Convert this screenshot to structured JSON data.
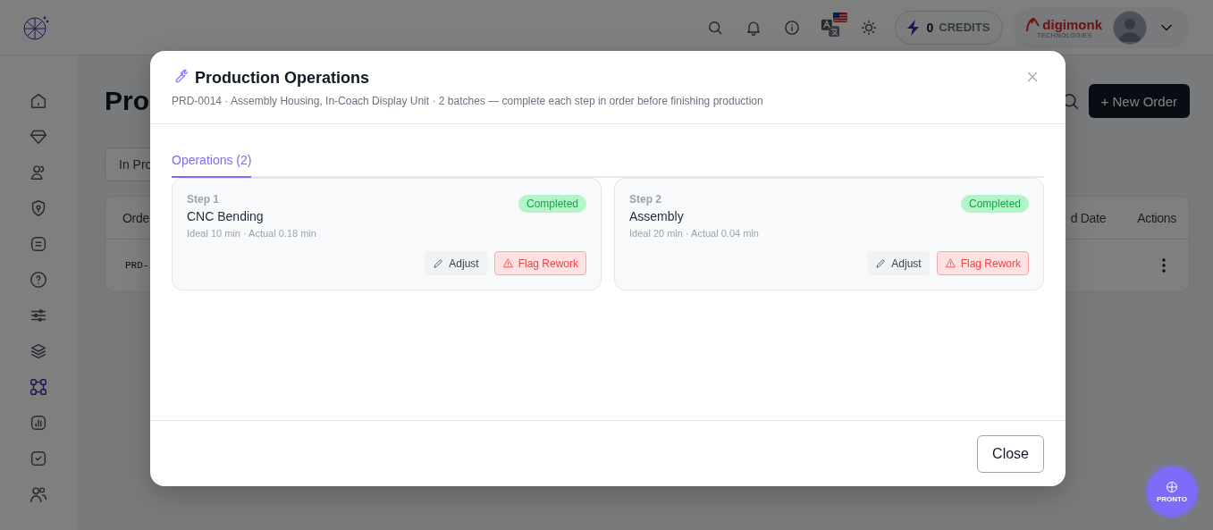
{
  "topbar": {
    "credits": {
      "count": "0",
      "label": "CREDITS"
    },
    "brand": {
      "name": "digimonk",
      "tagline": "TECHNOLOGIES"
    }
  },
  "sidebar": {
    "items": [
      {
        "selected": false
      },
      {
        "selected": false
      },
      {
        "selected": false
      },
      {
        "selected": false
      },
      {
        "selected": false
      },
      {
        "selected": false
      },
      {
        "selected": false
      },
      {
        "selected": false
      },
      {
        "selected": true
      },
      {
        "selected": false
      },
      {
        "selected": false
      },
      {
        "selected": false
      }
    ]
  },
  "page": {
    "title": "Pro",
    "filter_tab": "In Pro",
    "new_order_button": "+ New Order",
    "table": {
      "columns": [
        "Orde",
        "d Date",
        "Actions"
      ],
      "rows": [
        {
          "column_1": "PRD-"
        }
      ]
    }
  },
  "modal": {
    "title": "Production Operations",
    "subtitle": "PRD-0014 · Assembly Housing, In-Coach Display Unit · 2 batches — complete each step in order before finishing production",
    "tabs": [
      {
        "label": "Operations (2)",
        "selected": true
      }
    ],
    "steps": [
      {
        "step": "Step 1",
        "name": "CNC Bending",
        "meta": "Ideal 10 min · Actual 0.18 min",
        "status": "Completed",
        "actions": [
          {
            "label": "Adjust",
            "kind": "adjust"
          },
          {
            "label": "Flag Rework",
            "kind": "rework"
          }
        ]
      },
      {
        "step": "Step 2",
        "name": "Assembly",
        "meta": "Ideal 20 min · Actual 0.04 min",
        "status": "Completed",
        "actions": [
          {
            "label": "Adjust",
            "kind": "adjust"
          },
          {
            "label": "Flag Rework",
            "kind": "rework"
          }
        ]
      }
    ],
    "close_button": "Close"
  },
  "assistant": {
    "label": "PRONTO"
  }
}
